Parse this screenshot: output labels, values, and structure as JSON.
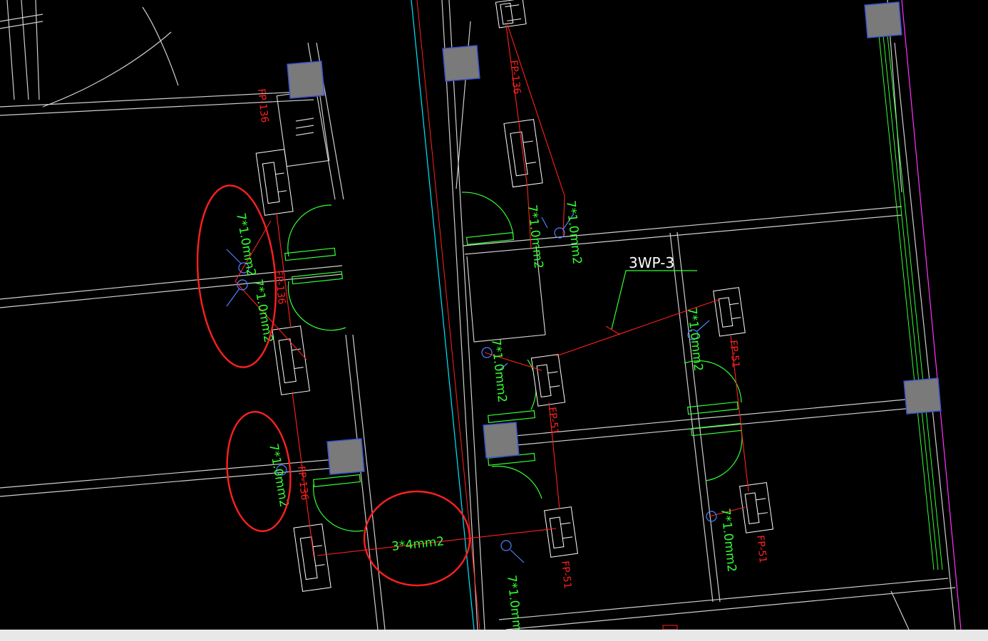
{
  "labels": {
    "panel_tag": "3WP-3",
    "cable_3x4": "3*4mm2",
    "cable_7x1": "7*1.0mm2",
    "circuit_fp136": "FP-136",
    "circuit_fp51": "FP-51"
  },
  "colors": {
    "background": "#000000",
    "wall": "#cfcfcf",
    "wire": "#ff2020",
    "cable_text": "#33ff33",
    "door": "#33ff33",
    "column_fill": "#7a7a7a",
    "column_edge": "#3c50d0",
    "highlight": "#ff2020",
    "edge_cyan": "#00e5ff",
    "edge_magenta": "#ff33ff",
    "statusbar": "#e8e8e8"
  }
}
